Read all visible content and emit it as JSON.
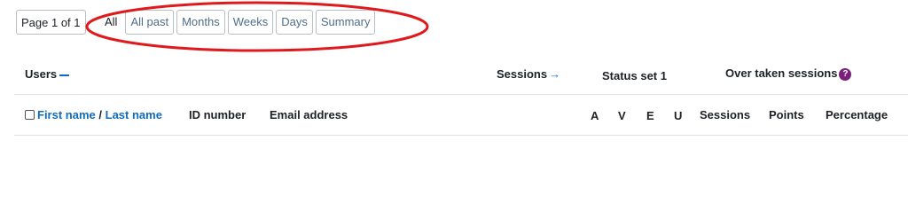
{
  "paging": {
    "indicator": "Page 1 of 1"
  },
  "filters": [
    {
      "label": "All",
      "active": true
    },
    {
      "label": "All past",
      "active": false
    },
    {
      "label": "Months",
      "active": false
    },
    {
      "label": "Weeks",
      "active": false
    },
    {
      "label": "Days",
      "active": false
    },
    {
      "label": "Summary",
      "active": false
    }
  ],
  "annotation": {
    "color": "#e0191c"
  },
  "table": {
    "group_header": {
      "users": "Users",
      "sessions": "Sessions",
      "status_set": "Status set 1",
      "over_taken": "Over taken sessions"
    },
    "columns": {
      "first_name": "First name",
      "separator": "/",
      "last_name": "Last name",
      "id_number": "ID number",
      "email": "Email address",
      "a": "A",
      "v": "V",
      "e": "E",
      "u": "U",
      "sessions": "Sessions",
      "points": "Points",
      "percentage": "Percentage"
    }
  },
  "icons": {
    "collapse": "minus-icon",
    "expand": "right-arrow-icon",
    "help": "question-mark-icon",
    "select": "checkbox-icon"
  },
  "colors": {
    "link": "#0f6cbf",
    "button_text": "#4e6d8c",
    "help_badge": "#7b1f7a"
  }
}
